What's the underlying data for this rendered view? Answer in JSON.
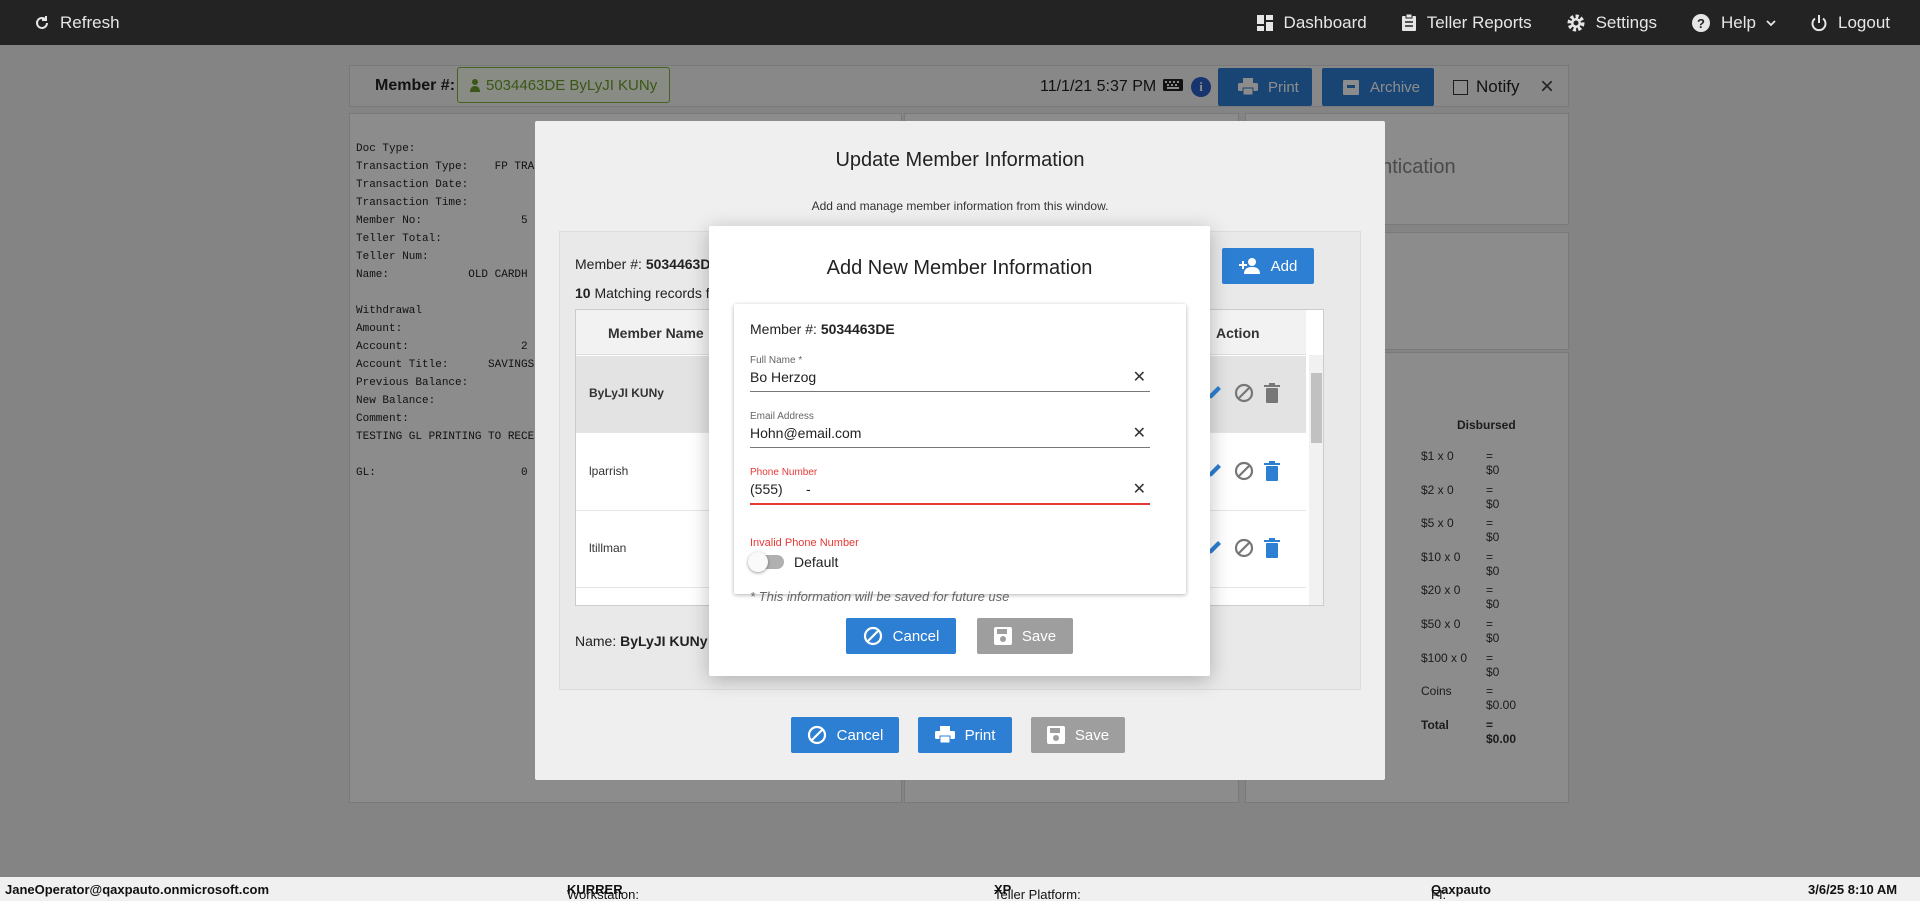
{
  "topbar": {
    "refresh": "Refresh",
    "nav": [
      {
        "label": "Dashboard",
        "icon": "dashboard-icon"
      },
      {
        "label": "Teller Reports",
        "icon": "clipboard-icon"
      },
      {
        "label": "Settings",
        "icon": "gear-icon"
      },
      {
        "label": "Help",
        "icon": "help-icon"
      },
      {
        "label": "Logout",
        "icon": "power-icon"
      }
    ]
  },
  "memberbar": {
    "label": "Member #:",
    "chip": "5034463DE ByLyJI KUNy",
    "datetime": "11/1/21 5:37 PM",
    "info": "i",
    "print": "Print",
    "archive": "Archive",
    "notify": "Notify",
    "close": "×"
  },
  "receipt": "Doc Type:\nTransaction Type:    FP TRA\nTransaction Date:\nTransaction Time:\nMember No:               5\nTeller Total:\nTeller Num:\nName:            OLD CARDH\n\nWithdrawal\nAmount:\nAccount:                 2\nAccount Title:      SAVINGS\nPrevious Balance:\nNew Balance:\nComment:\nTESTING GL PRINTING TO RECE\n\nGL:                      0",
  "right_panel": {
    "title_fragment": "entication",
    "disbursed_header": "Disbursed",
    "rows": [
      {
        "label": "$1 x 0",
        "value": "= $0"
      },
      {
        "label": "$2 x 0",
        "value": "= $0"
      },
      {
        "label": "$5 x 0",
        "value": "= $0"
      },
      {
        "label": "$10 x 0",
        "value": "= $0"
      },
      {
        "label": "$20 x 0",
        "value": "= $0"
      },
      {
        "label": "$50 x 0",
        "value": "= $0"
      },
      {
        "label": "$100 x 0",
        "value": "= $0"
      },
      {
        "label": "Coins",
        "value": "= $0.00"
      },
      {
        "label": "Total",
        "value": "= $0.00"
      }
    ]
  },
  "update_modal": {
    "title": "Update Member Information",
    "subtitle": "Add and manage member information from this window.",
    "member_label": "Member #:",
    "member_value": "5034463D",
    "matching_count": "10",
    "matching_text": "Matching records f",
    "add": "Add",
    "col_name": "Member Name",
    "col_action": "Action",
    "rows": [
      "ByLyJI KUNy",
      "lparrish",
      "ltillman"
    ],
    "name_label": "Name:",
    "name_value": "ByLyJI KUNy",
    "cancel": "Cancel",
    "print": "Print",
    "save": "Save"
  },
  "add_modal": {
    "title": "Add New Member Information",
    "member_label": "Member #:",
    "member_value": "5034463DE",
    "full_name_label": "Full Name *",
    "full_name_value": "Bo Herzog",
    "email_label": "Email Address",
    "email_value": "Hohn@email.com",
    "phone_label": "Phone Number",
    "phone_value": "(555)      -",
    "phone_error": "Invalid Phone Number",
    "default_label": "Default",
    "default_on": false,
    "note": "* This information will be saved for future use",
    "cancel": "Cancel",
    "save": "Save"
  },
  "status": {
    "user": "JaneOperator@qaxpauto.onmicrosoft.com",
    "workstation_label": "Workstation:",
    "workstation": "KURRER",
    "platform_label": "Teller Platform:",
    "platform": "XP",
    "fi_label": "FI:",
    "fi": "Qaxpauto",
    "datetime": "3/6/25 8:10 AM"
  },
  "colors": {
    "accent": "#2d7fd3",
    "error": "#e53935",
    "member_chip": "#6a9e2a",
    "topbar": "#232323"
  }
}
